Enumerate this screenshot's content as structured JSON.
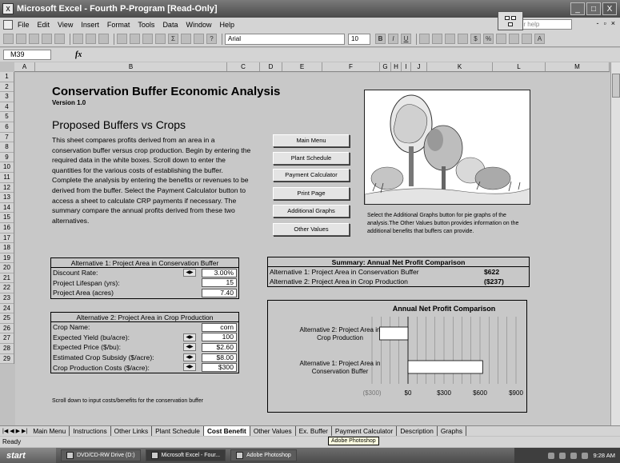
{
  "window": {
    "title": "Microsoft Excel - Fourth P-Program  [Read-Only]",
    "controls": [
      "_",
      "□",
      "X"
    ]
  },
  "menubar": {
    "items": [
      "File",
      "Edit",
      "View",
      "Insert",
      "Format",
      "Tools",
      "Data",
      "Window",
      "Help"
    ],
    "help_placeholder": "n for help"
  },
  "toolbar": {
    "font": "Arial",
    "size": "10",
    "bold": "B",
    "italic": "I",
    "underline": "U",
    "currency": "$",
    "percent": "%"
  },
  "formula_bar": {
    "name_box": "M39",
    "fx": "fx",
    "value": ""
  },
  "columns": [
    "A",
    "B",
    "C",
    "D",
    "E",
    "F",
    "G",
    "H",
    "I",
    "J",
    "K",
    "L",
    "M"
  ],
  "rows": [
    "1",
    "2",
    "3",
    "4",
    "5",
    "6",
    "7",
    "8",
    "9",
    "10",
    "11",
    "12",
    "13",
    "14",
    "15",
    "16",
    "17",
    "18",
    "19",
    "20",
    "21",
    "22",
    "23",
    "24",
    "25",
    "26",
    "27",
    "28",
    "29"
  ],
  "sheet": {
    "title": "Conservation Buffer Economic Analysis",
    "version": "Version 1.0",
    "subtitle": "Proposed Buffers vs Crops",
    "description": "This sheet compares profits derived from an area in a conservation buffer versus crop production.  Begin by entering the required data in the white boxes.  Scroll down to enter the quantities for the various costs of establishing the buffer.  Complete the analysis by entering the benefits or revenues to be derived from the buffer.  Select the Payment Calculator button to access a sheet to calculate CRP payments if necessary.  The summary compare the annual profits derived from these two alternatives.",
    "nav_buttons": [
      "Main Menu",
      "Plant Schedule",
      "Payment Calculator",
      "Print Page",
      "Additional Graphs",
      "Other Values"
    ],
    "picture_caption": "Select the Additional Graphs button for pie graphs of the analysis.The Other Values button provides information on the additional benefits that buffers can provide.",
    "scroll_note": "Scroll down to input costs/benefits for the conservation buffer"
  },
  "alt1": {
    "header": "Alternative 1: Project Area in Conservation Buffer",
    "rows": [
      {
        "label": "Discount Rate:",
        "value": "3.00%"
      },
      {
        "label": "Project Lifespan (yrs):",
        "value": "15"
      },
      {
        "label": "Project Area (acres)",
        "value": "7.40"
      }
    ]
  },
  "alt2": {
    "header": "Alternative 2: Project Area in Crop Production",
    "rows": [
      {
        "label": "Crop Name:",
        "value": "corn"
      },
      {
        "label": "Expected Yield (bu/acre):",
        "value": "100"
      },
      {
        "label": "Expected Price ($/bu):",
        "value": "$2.60"
      },
      {
        "label": "Estimated Crop Subsidy ($/acre):",
        "value": "$8.00"
      },
      {
        "label": "Crop Production Costs ($/acre):",
        "value": "$300"
      }
    ]
  },
  "summary": {
    "header": "Summary: Annual Net Profit Comparison",
    "rows": [
      {
        "label": "Alternative 1: Project Area in Conservation Buffer",
        "value": "$622"
      },
      {
        "label": "Alternative 2: Project Area in Crop Production",
        "value": "($237)"
      }
    ]
  },
  "chart_data": {
    "type": "bar",
    "orientation": "horizontal",
    "title": "Annual Net Profit Comparison",
    "categories": [
      "Alternative 2: Project Area in Crop Production",
      "Alternative 1: Project Area in Conservation Buffer"
    ],
    "values": [
      -237,
      622
    ],
    "xlim": [
      -300,
      900
    ],
    "xticks": [
      "($300)",
      "$0",
      "$300",
      "$600",
      "$900"
    ],
    "grid": true
  },
  "tabs": {
    "items": [
      "Main Menu",
      "Instructions",
      "Other Links",
      "Plant Schedule",
      "Cost Benefit",
      "Other Values",
      "Ex. Buffer",
      "Payment Calculator",
      "Description",
      "Graphs"
    ],
    "active": "Cost Benefit",
    "tooltip": "Adobe Photoshop"
  },
  "status": {
    "text": "Ready"
  },
  "taskbar": {
    "start": "start",
    "tasks": [
      "DVD/CD-RW Drive (D:)",
      "Microsoft Excel - Four...",
      "Adobe Photoshop"
    ],
    "time": "9:28 AM"
  }
}
